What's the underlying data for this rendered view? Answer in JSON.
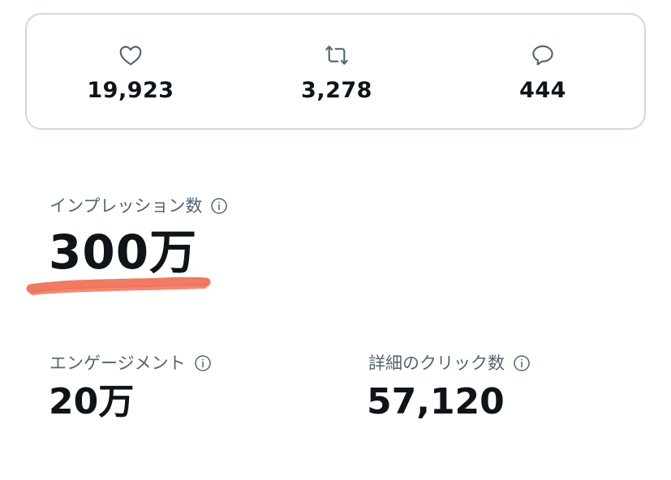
{
  "engagement_bar": {
    "likes": {
      "icon": "heart-icon",
      "value": "19,923"
    },
    "reposts": {
      "icon": "repost-icon",
      "value": "3,278"
    },
    "replies": {
      "icon": "reply-icon",
      "value": "444"
    }
  },
  "metrics": {
    "impressions": {
      "label": "インプレッション数",
      "value": "300万"
    },
    "engagements": {
      "label": "エンゲージメント",
      "value": "20万"
    },
    "detail_clicks": {
      "label": "詳細のクリック数",
      "value": "57,120"
    }
  },
  "colors": {
    "text_primary": "#0f1419",
    "text_secondary": "#536471",
    "card_border": "#cfd9de",
    "highlight_mark": "#f0735a"
  }
}
